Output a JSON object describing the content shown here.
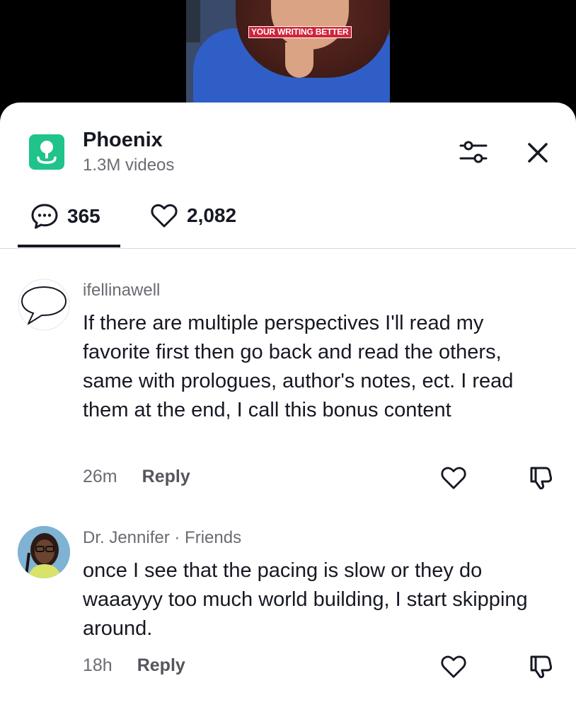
{
  "video": {
    "caption": "YOUR WRITING BETTER"
  },
  "header": {
    "title": "Phoenix",
    "subtitle": "1.3M videos"
  },
  "stats": {
    "comments": "365",
    "likes": "2,082"
  },
  "comments": [
    {
      "username": "ifellinawell",
      "text": "If there are multiple perspectives I'll read my favorite first then go back and read the others, same with prologues, author's notes, ect. I read them at the end, I call this bonus content",
      "time": "26m",
      "reply_label": "Reply"
    },
    {
      "username": "Dr. Jennifer · Friends",
      "text": "once I see that the pacing is slow or they do waaayyy too much world building, I start skipping around.",
      "time": "18h",
      "reply_label": "Reply"
    }
  ],
  "colors": {
    "topic_icon": "#20c38a",
    "text_primary": "#161823",
    "text_secondary": "#6b6b73"
  }
}
